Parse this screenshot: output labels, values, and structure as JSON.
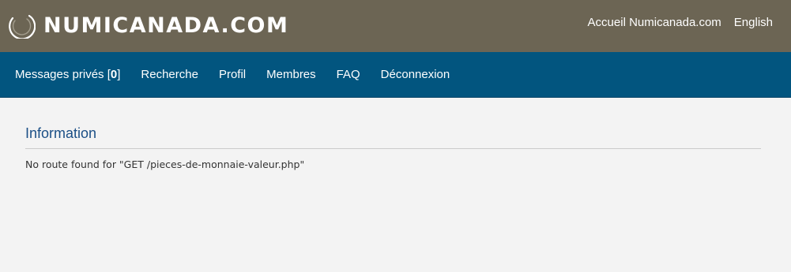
{
  "header": {
    "site_name": "NUMICANADA.COM",
    "logo_icon": "crescent-ring-logo",
    "links": [
      {
        "label": "Accueil Numicanada.com"
      },
      {
        "label": "English"
      }
    ],
    "background_color": "#6c6554"
  },
  "nav": {
    "background_color": "#02557f",
    "messages_label": "Messages privés [",
    "messages_count": "0",
    "messages_suffix": "]",
    "items": [
      {
        "label": "Recherche"
      },
      {
        "label": "Profil"
      },
      {
        "label": "Membres"
      },
      {
        "label": "FAQ"
      },
      {
        "label": "Déconnexion"
      }
    ]
  },
  "main": {
    "title": "Information",
    "message": "No route found for \"GET /pieces-de-monnaie-valeur.php\""
  }
}
